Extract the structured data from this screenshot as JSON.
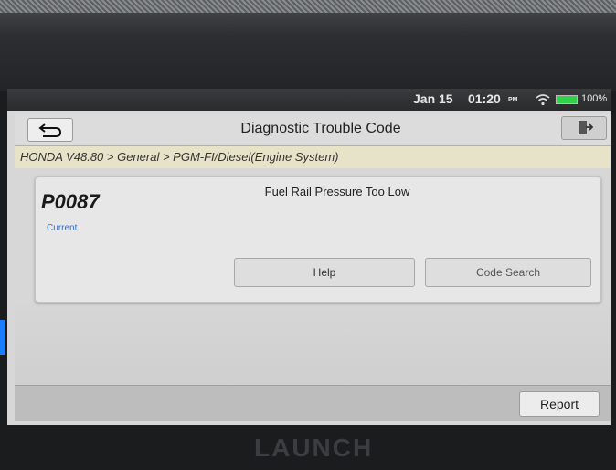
{
  "status_bar": {
    "date": "Jan 15",
    "time": "01:20",
    "ampm": "PM",
    "battery": "100%",
    "battery_color": "#33d14a",
    "wifi_icon": "wifi-icon",
    "battery_icon": "battery-icon"
  },
  "header": {
    "title": "Diagnostic Trouble Code",
    "back_icon": "back-arrow-icon",
    "exit_icon": "exit-door-icon"
  },
  "breadcrumb": "HONDA V48.80 > General > PGM-FI/Diesel(Engine System)",
  "dtc": {
    "code": "P0087",
    "status": "Current",
    "status_color": "#2f6fd0",
    "description": "Fuel Rail Pressure Too Low",
    "help_label": "Help",
    "code_search_label": "Code Search"
  },
  "footer": {
    "report_label": "Report"
  },
  "brand": "LAUNCH"
}
